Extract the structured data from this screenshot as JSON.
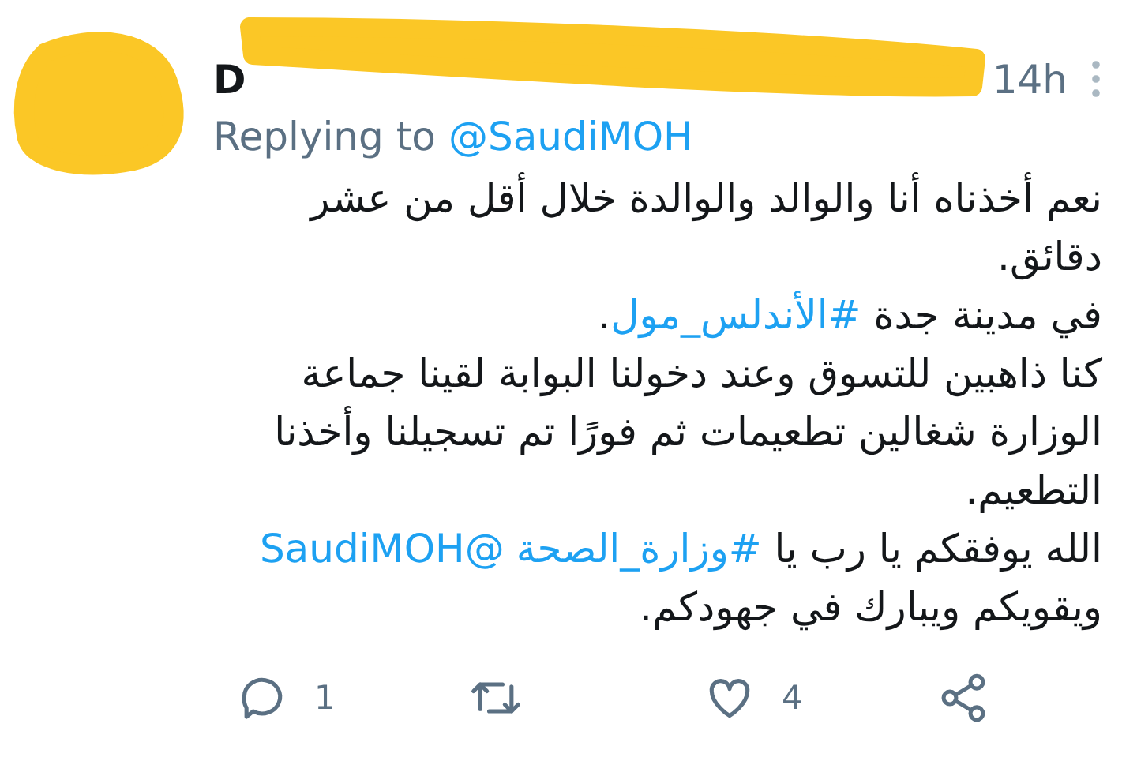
{
  "tweet": {
    "author_name": "D",
    "timestamp": "14h",
    "replying_label": "Replying to",
    "replying_handle": "@SaudiMOH",
    "lines": [
      [
        {
          "kind": "text",
          "text": "نعم أخذناه أنا والوالد والوالدة خلال أقل من عشر"
        }
      ],
      [
        {
          "kind": "text",
          "text": "دقائق."
        }
      ],
      [
        {
          "kind": "text",
          "text": "في مدينة جدة "
        },
        {
          "kind": "link",
          "text": "#الأندلس_مول"
        },
        {
          "kind": "text",
          "text": "."
        }
      ],
      [
        {
          "kind": "text",
          "text": "كنا ذاهبين للتسوق وعند دخولنا البوابة لقينا جماعة"
        }
      ],
      [
        {
          "kind": "text",
          "text": "الوزارة شغالين تطعيمات ثم فورًا تم تسجيلنا وأخذنا"
        }
      ],
      [
        {
          "kind": "text",
          "text": "التطعيم."
        }
      ],
      [
        {
          "kind": "text",
          "text": "الله يوفقكم يا رب يا "
        },
        {
          "kind": "link",
          "text": "#وزارة_الصحة"
        },
        {
          "kind": "link",
          "text": "@SaudiMOH"
        }
      ],
      [
        {
          "kind": "text",
          "text": "ويقويكم ويبارك في جهودكم."
        }
      ]
    ],
    "reply_count": "1",
    "like_count": "4"
  }
}
